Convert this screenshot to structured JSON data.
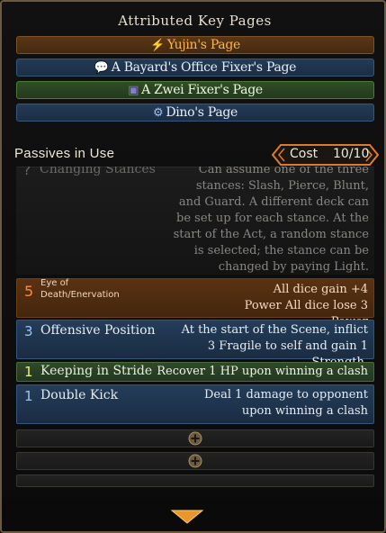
{
  "title": "Attributed Key Pages",
  "key_pages": [
    {
      "label": "Yujin's Page",
      "icon": "flame-slash-icon"
    },
    {
      "label": "A Bayard's Office Fixer's Page",
      "icon": "speech-bubble-icon"
    },
    {
      "label": "A Zwei Fixer's Page",
      "icon": "tower-card-icon"
    },
    {
      "label": "Dino's Page",
      "icon": "gear-badge-icon"
    }
  ],
  "passives": {
    "header": "Passives in Use",
    "cost_label": "Cost",
    "cost_value": "10/10",
    "items": [
      {
        "cost": "?",
        "name": "Changing Stances",
        "desc": "Can assume one of the three stances: Slash, Pierce, Blunt, and Guard. A different deck can be set up for each stance. At the start of the Act, a random stance is selected; the stance can be changed by paying Light."
      },
      {
        "cost": "5",
        "name": "Eye of Death/Enervation",
        "desc": "All dice gain +4 Power All dice lose 3 Power"
      },
      {
        "cost": "3",
        "name": "Offensive Position",
        "desc": "At the start of the Scene, inflict 3 Fragile to self and gain 1 Strength."
      },
      {
        "cost": "1",
        "name": "Keeping in Stride",
        "desc": "Recover 1 HP upon winning a clash"
      },
      {
        "cost": "1",
        "name": "Double Kick",
        "desc": "Deal 1 damage to opponent upon winning a clash"
      }
    ]
  },
  "colors": {
    "accent_orange": "#ff8a3a",
    "frame_gold": "#6b5a3e"
  }
}
